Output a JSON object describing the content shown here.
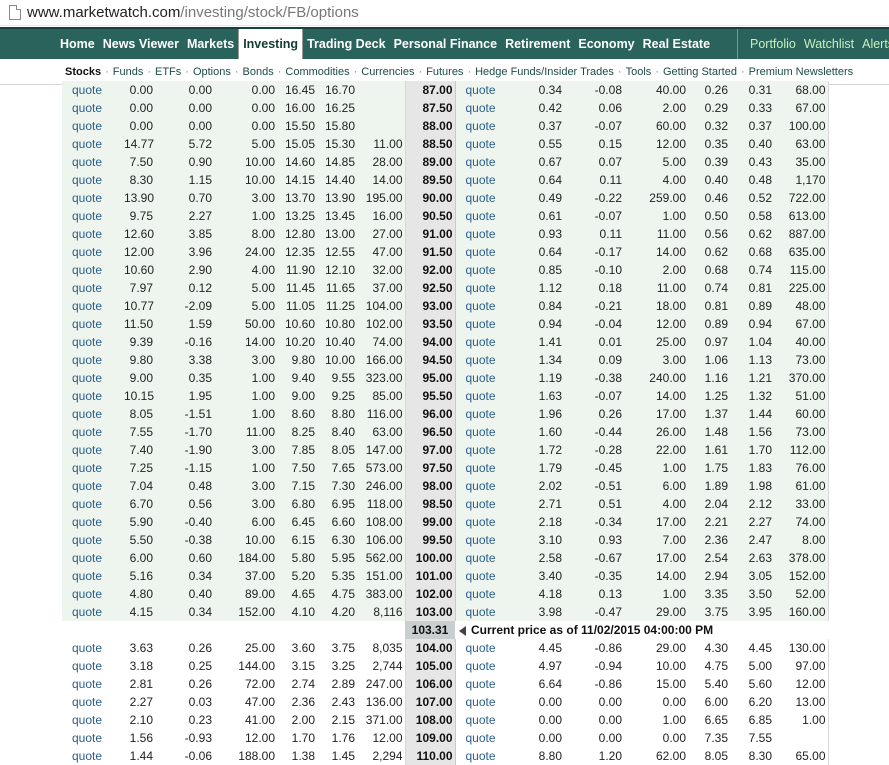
{
  "browser": {
    "url_host": "www.marketwatch.com",
    "url_path": "/investing/stock/FB/options"
  },
  "nav": {
    "main": [
      "Home",
      "News Viewer",
      "Markets",
      "Investing",
      "Trading Deck",
      "Personal Finance",
      "Retirement",
      "Economy",
      "Real Estate"
    ],
    "active": "Investing",
    "right": [
      "Portfolio",
      "Watchlist",
      "Alerts"
    ]
  },
  "subnav": [
    "Stocks",
    "Funds",
    "ETFs",
    "Options",
    "Bonds",
    "Commodities",
    "Currencies",
    "Futures",
    "Hedge Funds/Insider Trades",
    "Tools",
    "Getting Started",
    "Premium Newsletters"
  ],
  "link_text": "quote",
  "current_price": {
    "value": "103.31",
    "message": "Current price as of 11/02/2015 04:00:00 PM"
  },
  "rows_above": [
    [
      "0.00",
      "0.00",
      "0.00",
      "16.45",
      "16.70",
      "",
      "87.00",
      "0.34",
      "-0.08",
      "40.00",
      "0.26",
      "0.31",
      "68.00"
    ],
    [
      "0.00",
      "0.00",
      "0.00",
      "16.00",
      "16.25",
      "",
      "87.50",
      "0.42",
      "0.06",
      "2.00",
      "0.29",
      "0.33",
      "67.00"
    ],
    [
      "0.00",
      "0.00",
      "0.00",
      "15.50",
      "15.80",
      "",
      "88.00",
      "0.37",
      "-0.07",
      "60.00",
      "0.32",
      "0.37",
      "100.00"
    ],
    [
      "14.77",
      "5.72",
      "5.00",
      "15.05",
      "15.30",
      "11.00",
      "88.50",
      "0.55",
      "0.15",
      "12.00",
      "0.35",
      "0.40",
      "63.00"
    ],
    [
      "7.50",
      "0.90",
      "10.00",
      "14.60",
      "14.85",
      "28.00",
      "89.00",
      "0.67",
      "0.07",
      "5.00",
      "0.39",
      "0.43",
      "35.00"
    ],
    [
      "8.30",
      "1.15",
      "10.00",
      "14.15",
      "14.40",
      "14.00",
      "89.50",
      "0.64",
      "0.11",
      "4.00",
      "0.40",
      "0.48",
      "1,170"
    ],
    [
      "13.90",
      "0.70",
      "3.00",
      "13.70",
      "13.90",
      "195.00",
      "90.00",
      "0.49",
      "-0.22",
      "259.00",
      "0.46",
      "0.52",
      "722.00"
    ],
    [
      "9.75",
      "2.27",
      "1.00",
      "13.25",
      "13.45",
      "16.00",
      "90.50",
      "0.61",
      "-0.07",
      "1.00",
      "0.50",
      "0.58",
      "613.00"
    ],
    [
      "12.60",
      "3.85",
      "8.00",
      "12.80",
      "13.00",
      "27.00",
      "91.00",
      "0.93",
      "0.11",
      "11.00",
      "0.56",
      "0.62",
      "887.00"
    ],
    [
      "12.00",
      "3.96",
      "24.00",
      "12.35",
      "12.55",
      "47.00",
      "91.50",
      "0.64",
      "-0.17",
      "14.00",
      "0.62",
      "0.68",
      "635.00"
    ],
    [
      "10.60",
      "2.90",
      "4.00",
      "11.90",
      "12.10",
      "32.00",
      "92.00",
      "0.85",
      "-0.10",
      "2.00",
      "0.68",
      "0.74",
      "115.00"
    ],
    [
      "7.97",
      "0.12",
      "5.00",
      "11.45",
      "11.65",
      "37.00",
      "92.50",
      "1.12",
      "0.18",
      "11.00",
      "0.74",
      "0.81",
      "225.00"
    ],
    [
      "10.77",
      "-2.09",
      "5.00",
      "11.05",
      "11.25",
      "104.00",
      "93.00",
      "0.84",
      "-0.21",
      "18.00",
      "0.81",
      "0.89",
      "48.00"
    ],
    [
      "11.50",
      "1.59",
      "50.00",
      "10.60",
      "10.80",
      "102.00",
      "93.50",
      "0.94",
      "-0.04",
      "12.00",
      "0.89",
      "0.94",
      "67.00"
    ],
    [
      "9.39",
      "-0.16",
      "14.00",
      "10.20",
      "10.40",
      "74.00",
      "94.00",
      "1.41",
      "0.01",
      "25.00",
      "0.97",
      "1.04",
      "40.00"
    ],
    [
      "9.80",
      "3.38",
      "3.00",
      "9.80",
      "10.00",
      "166.00",
      "94.50",
      "1.34",
      "0.09",
      "3.00",
      "1.06",
      "1.13",
      "73.00"
    ],
    [
      "9.00",
      "0.35",
      "1.00",
      "9.40",
      "9.55",
      "323.00",
      "95.00",
      "1.19",
      "-0.38",
      "240.00",
      "1.16",
      "1.21",
      "370.00"
    ],
    [
      "10.15",
      "1.95",
      "1.00",
      "9.00",
      "9.25",
      "85.00",
      "95.50",
      "1.63",
      "-0.07",
      "14.00",
      "1.25",
      "1.32",
      "51.00"
    ],
    [
      "8.05",
      "-1.51",
      "1.00",
      "8.60",
      "8.80",
      "116.00",
      "96.00",
      "1.96",
      "0.26",
      "17.00",
      "1.37",
      "1.44",
      "60.00"
    ],
    [
      "7.55",
      "-1.70",
      "11.00",
      "8.25",
      "8.40",
      "63.00",
      "96.50",
      "1.60",
      "-0.44",
      "26.00",
      "1.48",
      "1.56",
      "73.00"
    ],
    [
      "7.40",
      "-1.90",
      "3.00",
      "7.85",
      "8.05",
      "147.00",
      "97.00",
      "1.72",
      "-0.28",
      "22.00",
      "1.61",
      "1.70",
      "112.00"
    ],
    [
      "7.25",
      "-1.15",
      "1.00",
      "7.50",
      "7.65",
      "573.00",
      "97.50",
      "1.79",
      "-0.45",
      "1.00",
      "1.75",
      "1.83",
      "76.00"
    ],
    [
      "7.04",
      "0.48",
      "3.00",
      "7.15",
      "7.30",
      "246.00",
      "98.00",
      "2.02",
      "-0.51",
      "6.00",
      "1.89",
      "1.98",
      "61.00"
    ],
    [
      "6.70",
      "0.56",
      "3.00",
      "6.80",
      "6.95",
      "118.00",
      "98.50",
      "2.71",
      "0.51",
      "4.00",
      "2.04",
      "2.12",
      "33.00"
    ],
    [
      "5.90",
      "-0.40",
      "6.00",
      "6.45",
      "6.60",
      "108.00",
      "99.00",
      "2.18",
      "-0.34",
      "17.00",
      "2.21",
      "2.27",
      "74.00"
    ],
    [
      "5.50",
      "-0.38",
      "10.00",
      "6.15",
      "6.30",
      "106.00",
      "99.50",
      "3.10",
      "0.93",
      "7.00",
      "2.36",
      "2.47",
      "8.00"
    ],
    [
      "6.00",
      "0.60",
      "184.00",
      "5.80",
      "5.95",
      "562.00",
      "100.00",
      "2.58",
      "-0.67",
      "17.00",
      "2.54",
      "2.63",
      "378.00"
    ],
    [
      "5.16",
      "0.34",
      "37.00",
      "5.20",
      "5.35",
      "151.00",
      "101.00",
      "3.40",
      "-0.35",
      "14.00",
      "2.94",
      "3.05",
      "152.00"
    ],
    [
      "4.80",
      "0.40",
      "89.00",
      "4.65",
      "4.75",
      "383.00",
      "102.00",
      "4.18",
      "0.13",
      "1.00",
      "3.35",
      "3.50",
      "52.00"
    ],
    [
      "4.15",
      "0.34",
      "152.00",
      "4.10",
      "4.20",
      "8,116",
      "103.00",
      "3.98",
      "-0.47",
      "29.00",
      "3.75",
      "3.95",
      "160.00"
    ]
  ],
  "rows_below": [
    [
      "3.63",
      "0.26",
      "25.00",
      "3.60",
      "3.75",
      "8,035",
      "104.00",
      "4.45",
      "-0.86",
      "29.00",
      "4.30",
      "4.45",
      "130.00"
    ],
    [
      "3.18",
      "0.25",
      "144.00",
      "3.15",
      "3.25",
      "2,744",
      "105.00",
      "4.97",
      "-0.94",
      "10.00",
      "4.75",
      "5.00",
      "97.00"
    ],
    [
      "2.81",
      "0.26",
      "72.00",
      "2.74",
      "2.89",
      "247.00",
      "106.00",
      "6.64",
      "-0.86",
      "15.00",
      "5.40",
      "5.60",
      "12.00"
    ],
    [
      "2.27",
      "0.03",
      "47.00",
      "2.36",
      "2.43",
      "136.00",
      "107.00",
      "0.00",
      "0.00",
      "0.00",
      "6.00",
      "6.20",
      "13.00"
    ],
    [
      "2.10",
      "0.23",
      "41.00",
      "2.00",
      "2.15",
      "371.00",
      "108.00",
      "0.00",
      "0.00",
      "1.00",
      "6.65",
      "6.85",
      "1.00"
    ],
    [
      "1.56",
      "-0.93",
      "12.00",
      "1.70",
      "1.76",
      "12.00",
      "109.00",
      "0.00",
      "0.00",
      "0.00",
      "7.35",
      "7.55",
      ""
    ],
    [
      "1.44",
      "-0.06",
      "188.00",
      "1.38",
      "1.45",
      "2,294",
      "110.00",
      "8.80",
      "1.20",
      "62.00",
      "8.05",
      "8.30",
      "65.00"
    ]
  ]
}
